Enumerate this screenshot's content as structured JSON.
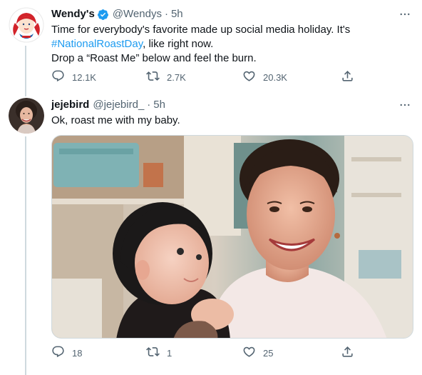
{
  "tweets": [
    {
      "name": "Wendy's",
      "verified": true,
      "handle": "@Wendys",
      "separator": "·",
      "time": "5h",
      "lines": [
        {
          "before": "Time for everybody's favorite made up social media holiday. It's",
          "hashtag": "",
          "after": ""
        },
        {
          "before": "",
          "hashtag": "#NationalRoastDay",
          "after": ", like right now."
        },
        {
          "before": "Drop a “Roast Me” below and feel the burn.",
          "hashtag": "",
          "after": ""
        }
      ],
      "actions": {
        "replies": "12.1K",
        "retweets": "2.7K",
        "likes": "20.3K"
      }
    },
    {
      "name": "jejebird",
      "verified": false,
      "handle": "@jejebird_",
      "separator": "·",
      "time": "5h",
      "text": "Ok, roast me with my baby.",
      "actions": {
        "replies": "18",
        "retweets": "1",
        "likes": "25"
      }
    }
  ],
  "icons": {
    "reply": "reply-icon",
    "retweet": "retweet-icon",
    "like": "heart-icon",
    "share": "share-icon",
    "more": "more-icon",
    "verified": "verified-badge-icon"
  },
  "colors": {
    "accent": "#1d9bf0",
    "wendys_red": "#d2232a",
    "muted_text": "#536471",
    "thread_line": "#cfd9de"
  }
}
